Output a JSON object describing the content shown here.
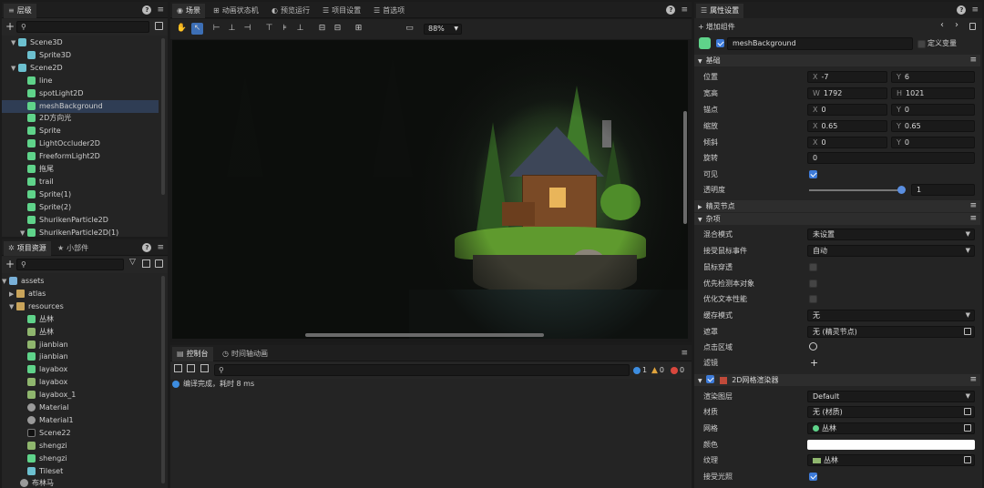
{
  "hierarchy": {
    "tab": "层级",
    "items": [
      {
        "label": "Scene3D",
        "icon": "cube-icon"
      },
      {
        "label": "Sprite3D",
        "icon": "cube-icon"
      },
      {
        "label": "Scene2D",
        "icon": "cube-icon"
      },
      {
        "label": "line",
        "icon": "node-icon"
      },
      {
        "label": "spotLight2D",
        "icon": "node-icon"
      },
      {
        "label": "meshBackground",
        "icon": "node-icon"
      },
      {
        "label": "2D方向光",
        "icon": "node-icon"
      },
      {
        "label": "Sprite",
        "icon": "node-icon"
      },
      {
        "label": "LightOccluder2D",
        "icon": "node-icon"
      },
      {
        "label": "FreeformLight2D",
        "icon": "node-icon"
      },
      {
        "label": "拖尾",
        "icon": "node-icon"
      },
      {
        "label": "trail",
        "icon": "node-icon"
      },
      {
        "label": "Sprite(1)",
        "icon": "node-icon"
      },
      {
        "label": "Sprite(2)",
        "icon": "node-icon"
      },
      {
        "label": "ShurikenParticle2D",
        "icon": "node-icon"
      },
      {
        "label": "ShurikenParticle2D(1)",
        "icon": "node-icon"
      }
    ]
  },
  "assets": {
    "tab1": "项目资源",
    "tab2": "小部件",
    "items": [
      {
        "label": "assets"
      },
      {
        "label": "atlas"
      },
      {
        "label": "resources"
      },
      {
        "label": "丛林"
      },
      {
        "label": "丛林"
      },
      {
        "label": "jianbian"
      },
      {
        "label": "jianbian"
      },
      {
        "label": "layabox"
      },
      {
        "label": "layabox"
      },
      {
        "label": "layabox_1"
      },
      {
        "label": "Material"
      },
      {
        "label": "Material1"
      },
      {
        "label": "Scene22"
      },
      {
        "label": "shengzi"
      },
      {
        "label": "shengzi"
      },
      {
        "label": "Tileset"
      },
      {
        "label": "布林马"
      }
    ]
  },
  "scene": {
    "tabs": [
      "场景",
      "动画状态机",
      "预览运行",
      "项目设置",
      "首选项"
    ],
    "zoom": "88%"
  },
  "console": {
    "tabs": [
      "控制台",
      "时间轴动画"
    ],
    "info_count": "1",
    "warn_count": "0",
    "error_count": "0",
    "message": "编译完成，耗时 8 ms"
  },
  "inspector": {
    "tab": "属性设置",
    "add_component": "增加组件",
    "node_name": "meshBackground",
    "custom_var": "定义变量",
    "sec_basic": "基础",
    "pos_label": "位置",
    "pos_x": "-7",
    "pos_y": "6",
    "size_label": "宽高",
    "size_w": "1792",
    "size_h": "1021",
    "anchor_label": "锚点",
    "anchor_x": "0",
    "anchor_y": "0",
    "scale_label": "缩放",
    "scale_x": "0.65",
    "scale_y": "0.65",
    "skew_label": "倾斜",
    "skew_x": "0",
    "skew_y": "0",
    "rotation_label": "旋转",
    "rotation": "0",
    "visible_label": "可见",
    "alpha_label": "透明度",
    "alpha": "1",
    "sec_sprite": "精灵节点",
    "sec_misc": "杂项",
    "blend_label": "混合模式",
    "blend": "未设置",
    "mouse_label": "接受鼠标事件",
    "mouse": "自动",
    "mousethrough_label": "鼠标穿透",
    "hittest_label": "优先检测本对象",
    "textopt_label": "优化文本性能",
    "cache_label": "缓存模式",
    "cache": "无",
    "mask_label": "遮罩",
    "mask": "无 (精灵节点)",
    "hitarea_label": "点击区域",
    "filter_label": "滤镜",
    "sec_renderer": "2D网格渲染器",
    "layer_label": "渲染图层",
    "layer": "Default",
    "material_label": "材质",
    "material": "无 (材质)",
    "mesh_label": "网格",
    "mesh": "丛林",
    "color_label": "颜色",
    "texture_label": "纹理",
    "texture": "丛林",
    "light_label": "接受光照"
  }
}
